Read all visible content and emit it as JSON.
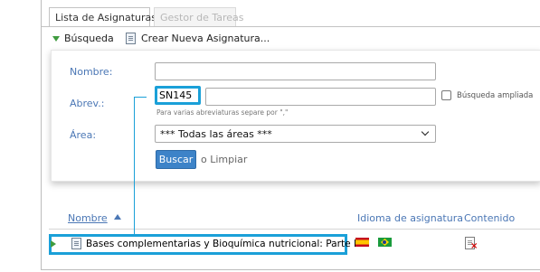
{
  "tabs": [
    {
      "label": "Lista de Asignaturas",
      "active": true
    },
    {
      "label": "Gestor de Tareas",
      "active": false
    }
  ],
  "toolbar": {
    "search_label": "Búsqueda",
    "new_label": "Crear Nueva Asignatura..."
  },
  "search": {
    "nombre_label": "Nombre:",
    "nombre_value": "",
    "abrev_label": "Abrev.:",
    "abrev_value": "SN145",
    "abrev_hint": "Para varias abreviaturas separe por \",\"",
    "extended_label": "Búsqueda ampliada",
    "extended_checked": false,
    "area_label": "Área:",
    "area_selected": "*** Todas las áreas ***",
    "buscar_label": "Buscar",
    "limpiar_label": "o Limpiar"
  },
  "results": {
    "headers": {
      "nombre": "Nombre",
      "idioma": "Idioma de asignatura",
      "contenido": "Contenido"
    },
    "sort": "ascending",
    "rows": [
      {
        "title": "Bases complementarias y Bioquímica nutricional: Parte I",
        "languages": [
          "flag-es-icon",
          "flag-br-icon"
        ],
        "content_icon": "content-missing-icon"
      }
    ]
  },
  "colors": {
    "accent_blue": "#4b77b5",
    "highlight_callout": "#1aa0d8",
    "button_blue": "#3d83c8",
    "expand_green": "#3f9b3f"
  }
}
